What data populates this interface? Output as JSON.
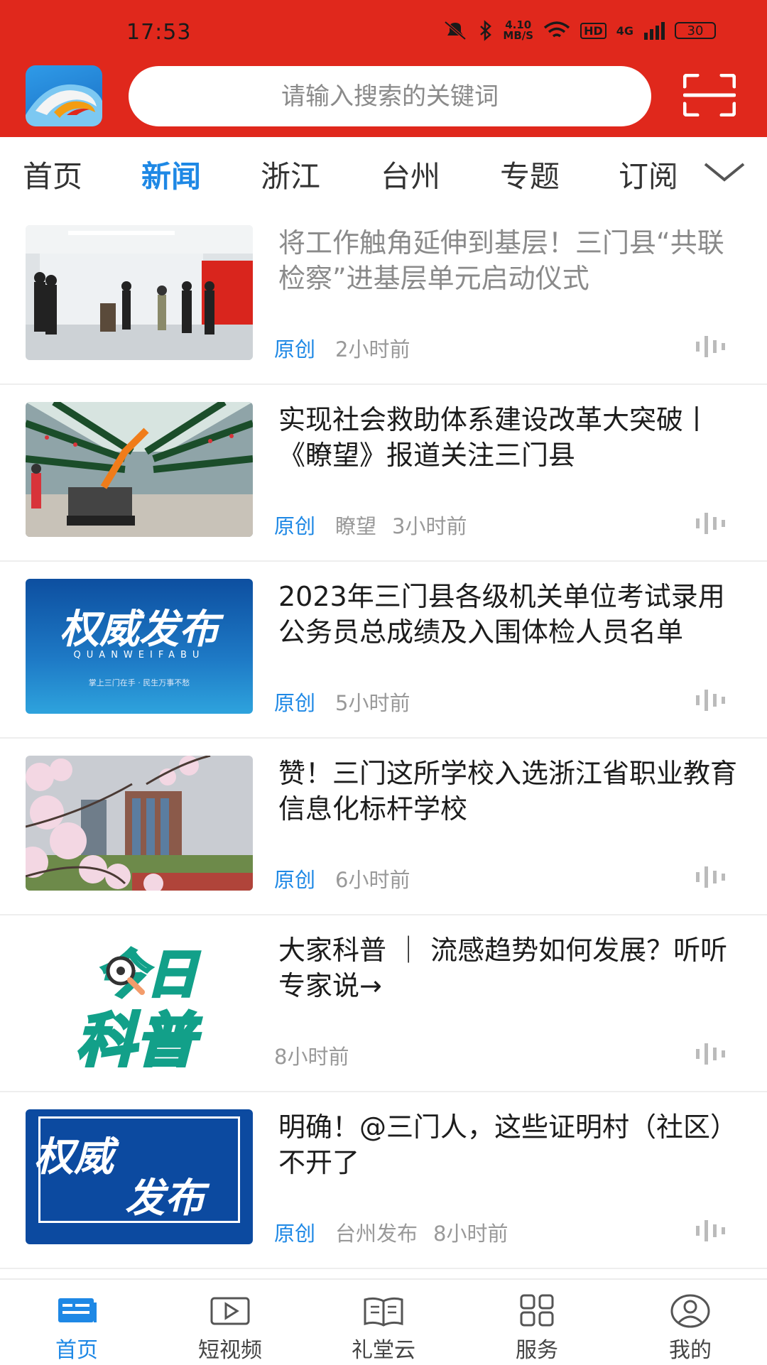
{
  "status_bar": {
    "time": "17:53",
    "speed_value": "4.10",
    "speed_unit": "MB/S",
    "hd_label": "HD",
    "network_label": "4G",
    "battery": "30",
    "icons": [
      "mute-icon",
      "bluetooth-icon",
      "wifi-icon",
      "signal-icon",
      "battery-icon"
    ]
  },
  "header": {
    "search_placeholder": "请输入搜索的关键词",
    "accent_color": "#e0281c"
  },
  "tabs": {
    "items": [
      "首页",
      "新闻",
      "浙江",
      "台州",
      "专题",
      "订阅"
    ],
    "active": "新闻"
  },
  "news": [
    {
      "title": "将工作触角延伸到基层！三门县“共联检察”进基层单元启动仪式",
      "tag": "原创",
      "source": "",
      "time": "2小时前",
      "read": true
    },
    {
      "title": "实现社会救助体系建设改革大突破丨《瞭望》报道关注三门县",
      "tag": "原创",
      "source": "瞭望",
      "time": "3小时前",
      "read": false
    },
    {
      "title": "2023年三门县各级机关单位考试录用公务员总成绩及入围体检人员名单",
      "tag": "原创",
      "source": "",
      "time": "5小时前",
      "read": false,
      "thumb_title": "权威发布",
      "thumb_sub": "QUANWEIFABU",
      "thumb_caption": "掌上三门在手 · 民生万事不愁"
    },
    {
      "title": "赞！三门这所学校入选浙江省职业教育信息化标杆学校",
      "tag": "原创",
      "source": "",
      "time": "6小时前",
      "read": false
    },
    {
      "title": "大家科普 ｜ 流感趋势如何发展？听听专家说→",
      "tag": "",
      "source": "",
      "time": "8小时前",
      "read": false,
      "thumb_title_1": "今日",
      "thumb_title_2": "科普"
    },
    {
      "title": "明确！@三门人，这些证明村（社区）不开了",
      "tag": "原创",
      "source": "台州发布",
      "time": "8小时前",
      "read": false,
      "thumb_title_1": "权威",
      "thumb_title_2": "发布"
    }
  ],
  "bottom_nav": {
    "items": [
      {
        "label": "首页",
        "icon": "news-home-icon"
      },
      {
        "label": "短视频",
        "icon": "video-play-icon"
      },
      {
        "label": "礼堂云",
        "icon": "open-book-icon"
      },
      {
        "label": "服务",
        "icon": "grid-apps-icon"
      },
      {
        "label": "我的",
        "icon": "profile-icon"
      }
    ],
    "active": "首页",
    "active_color": "#1e88e5"
  }
}
